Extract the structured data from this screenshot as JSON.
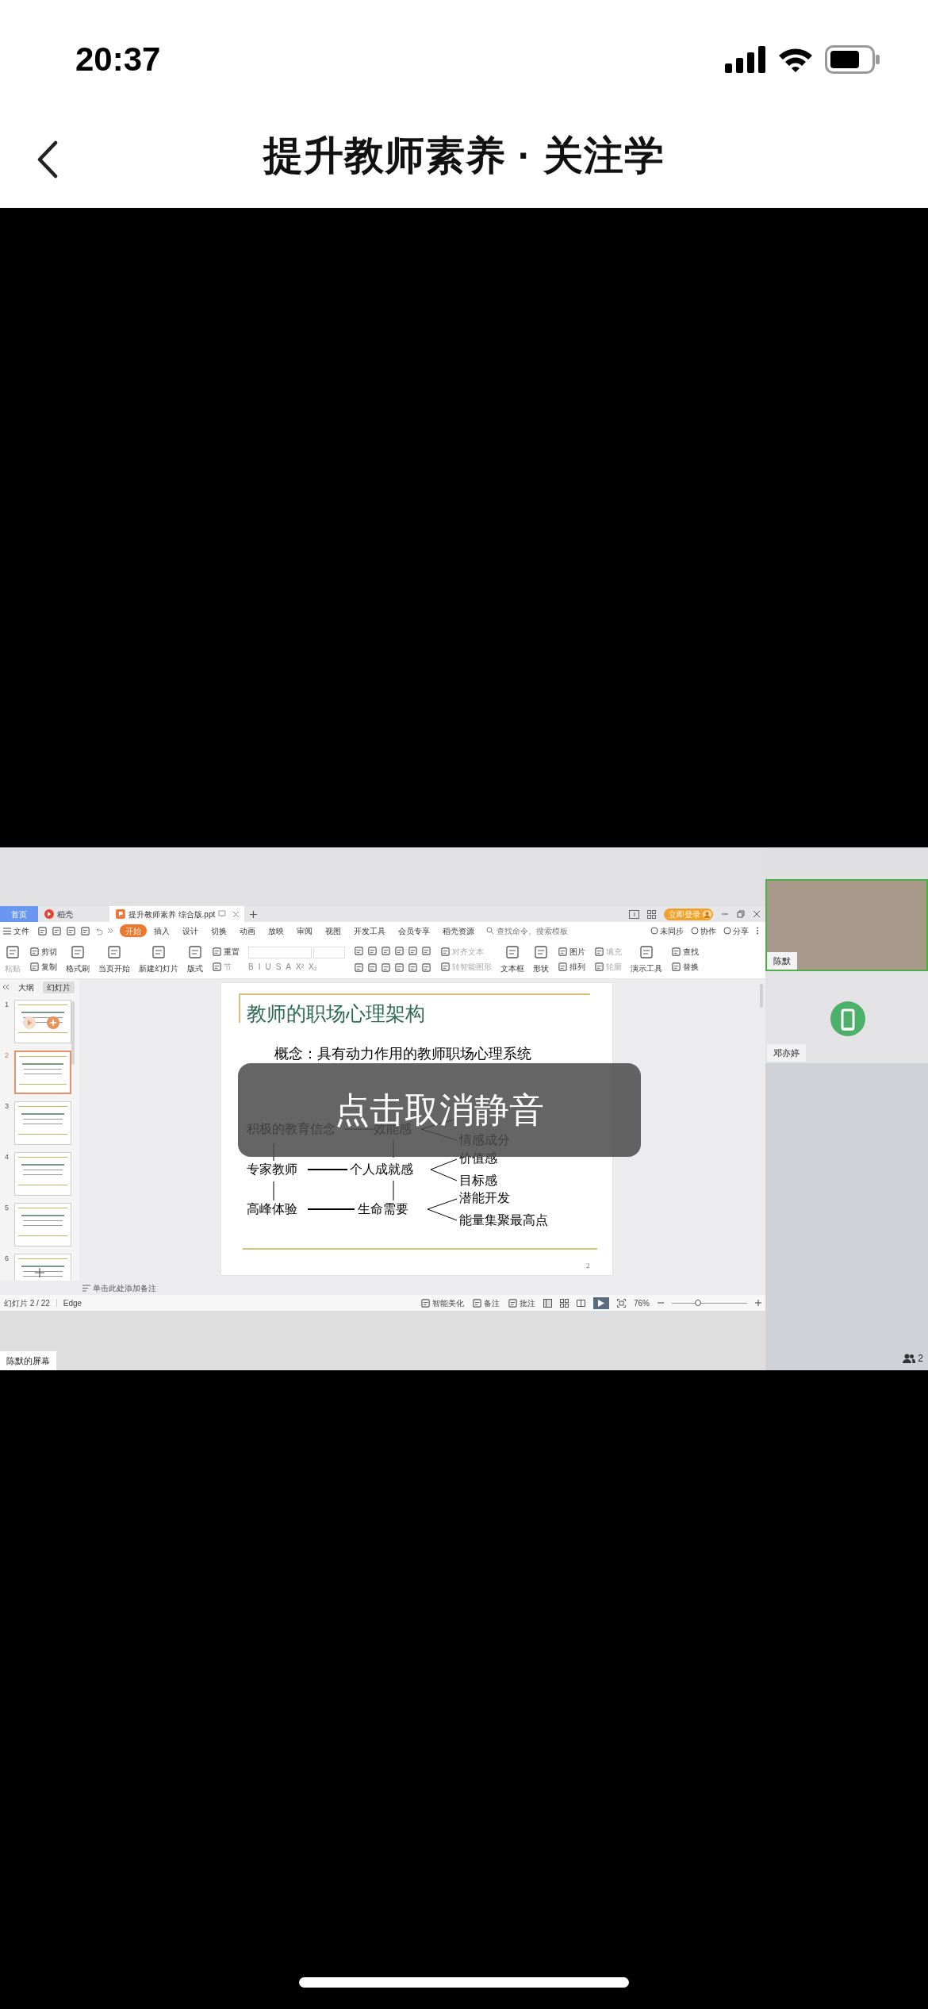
{
  "status_bar": {
    "time": "20:37"
  },
  "nav": {
    "title": "提升教师素养 · 关注学"
  },
  "wps": {
    "tabs": [
      {
        "label": "首页",
        "kind": "home",
        "selected": false
      },
      {
        "label": "稻壳",
        "kind": "docer",
        "selected": false
      },
      {
        "label": "提升教师素养 综合版.ppt",
        "kind": "file",
        "selected": true
      }
    ],
    "login": "立即登录",
    "file_menu": "文件",
    "menu_tabs": [
      {
        "label": "开始",
        "selected": true
      },
      {
        "label": "插入",
        "selected": false
      },
      {
        "label": "设计",
        "selected": false
      },
      {
        "label": "切换",
        "selected": false
      },
      {
        "label": "动画",
        "selected": false
      },
      {
        "label": "放映",
        "selected": false
      },
      {
        "label": "审阅",
        "selected": false
      },
      {
        "label": "视图",
        "selected": false
      },
      {
        "label": "开发工具",
        "selected": false
      },
      {
        "label": "会员专享",
        "selected": false
      },
      {
        "label": "稻壳资源",
        "selected": false
      }
    ],
    "search": {
      "placeholder": "查找命令、搜索模板"
    },
    "menu_actions": [
      "未同步",
      "协作",
      "分享"
    ],
    "ribbon": [
      {
        "kind": "buttons",
        "items": [
          {
            "label": "粘贴",
            "kind": "large",
            "disabled": true
          }
        ]
      },
      {
        "kind": "buttons",
        "items": [
          {
            "label": "剪切",
            "kind": "small",
            "disabled": false
          },
          {
            "label": "复制",
            "kind": "small",
            "disabled": false
          }
        ]
      },
      {
        "kind": "buttons",
        "items": [
          {
            "label": "格式刷",
            "kind": "large",
            "disabled": false
          }
        ]
      },
      {
        "kind": "buttons",
        "items": [
          {
            "label": "当页开始",
            "kind": "large",
            "disabled": false
          }
        ]
      },
      {
        "kind": "buttons",
        "items": [
          {
            "label": "新建幻灯片",
            "kind": "large",
            "disabled": false
          }
        ]
      },
      {
        "kind": "buttons",
        "items": [
          {
            "label": "版式",
            "kind": "large",
            "disabled": false
          }
        ]
      },
      {
        "kind": "buttons",
        "items": [
          {
            "label": "重置",
            "kind": "small",
            "disabled": false
          },
          {
            "label": "节",
            "kind": "small",
            "disabled": true
          }
        ]
      },
      {
        "kind": "font",
        "format_buttons": [
          "B",
          "I",
          "U",
          "S",
          "A",
          "X²",
          "X₂"
        ]
      },
      {
        "kind": "icon_grid"
      },
      {
        "kind": "buttons",
        "items": [
          {
            "label": "对齐文本",
            "kind": "small",
            "disabled": true
          },
          {
            "label": "转智能图形",
            "kind": "small",
            "disabled": true
          }
        ]
      },
      {
        "kind": "buttons",
        "items": [
          {
            "label": "文本框",
            "kind": "large",
            "disabled": false
          }
        ]
      },
      {
        "kind": "buttons",
        "items": [
          {
            "label": "形状",
            "kind": "large",
            "disabled": false
          }
        ]
      },
      {
        "kind": "buttons",
        "items": [
          {
            "label": "图片",
            "kind": "small",
            "disabled": false
          },
          {
            "label": "排列",
            "kind": "small",
            "disabled": false
          }
        ]
      },
      {
        "kind": "buttons",
        "items": [
          {
            "label": "填充",
            "kind": "small",
            "disabled": true
          },
          {
            "label": "轮廓",
            "kind": "small",
            "disabled": true
          }
        ]
      },
      {
        "kind": "buttons",
        "items": [
          {
            "label": "演示工具",
            "kind": "large",
            "disabled": false
          }
        ]
      },
      {
        "kind": "buttons",
        "items": [
          {
            "label": "查找",
            "kind": "small",
            "disabled": false
          },
          {
            "label": "替换",
            "kind": "small",
            "disabled": false
          }
        ]
      }
    ],
    "panel_tabs": [
      {
        "label": "大纲",
        "selected": false
      },
      {
        "label": "幻灯片",
        "selected": true
      }
    ],
    "slides": [
      {
        "number": "1",
        "selected": false,
        "hovered": true
      },
      {
        "number": "2",
        "selected": true,
        "hovered": false
      },
      {
        "number": "3",
        "selected": false,
        "hovered": false
      },
      {
        "number": "4",
        "selected": false,
        "hovered": false
      },
      {
        "number": "5",
        "selected": false,
        "hovered": false
      },
      {
        "number": "6",
        "selected": false,
        "hovered": false
      }
    ],
    "slide": {
      "title": "教师的职场心理架构",
      "concept": "概念：具有动力作用的教师职场心理系统",
      "rows": [
        {
          "left": "积极的教育信念",
          "middle": "效能感",
          "branches": [
            "情感成分"
          ]
        },
        {
          "left": "专家教师",
          "middle": "个人成就感",
          "branches": [
            "价值感",
            "目标感"
          ]
        },
        {
          "left": "高峰体验",
          "middle": "生命需要",
          "branches": [
            "潜能开发",
            "能量集聚最高点"
          ]
        }
      ],
      "page_number": "2"
    },
    "notes_placeholder": "单击此处添加备注",
    "status": {
      "slide_counter": "幻灯片 2 / 22",
      "theme": "Edge",
      "actions": [
        "智能美化",
        "备注",
        "批注"
      ],
      "zoom": "76%",
      "zoom_slider": {
        "level": 0.35
      }
    },
    "screen_label": "陈默的屏幕"
  },
  "toast": "点击取消静音",
  "participants": [
    {
      "name": "陈默",
      "kind": "video",
      "active": true
    },
    {
      "name": "邓亦婷",
      "kind": "avatar",
      "active": false
    }
  ],
  "participant_count": "2"
}
